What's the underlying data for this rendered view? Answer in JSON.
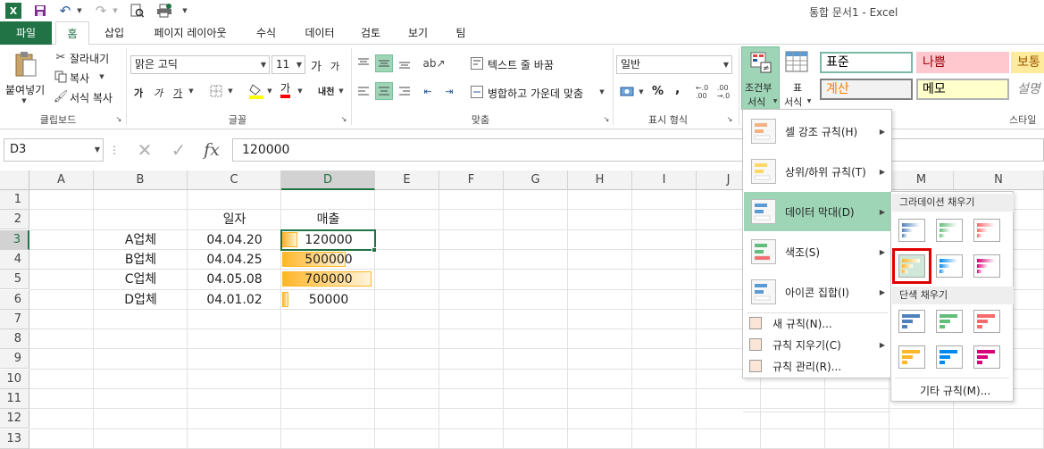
{
  "window": {
    "title": "통합 문서1 - Excel"
  },
  "tabs": [
    {
      "label": "파일"
    },
    {
      "label": "홈"
    },
    {
      "label": "삽입"
    },
    {
      "label": "페이지 레이아웃"
    },
    {
      "label": "수식"
    },
    {
      "label": "데이터"
    },
    {
      "label": "검토"
    },
    {
      "label": "보기"
    },
    {
      "label": "팀"
    }
  ],
  "ribbon": {
    "clipboard": {
      "paste": "붙여넣기",
      "cut": "잘라내기",
      "copy": "복사",
      "format_painter": "서식 복사",
      "group": "클립보드"
    },
    "font": {
      "name": "맑은 고딕",
      "size": "11",
      "group": "글꼴",
      "grow": "가",
      "shrink": "가",
      "bold": "가",
      "italic": "가",
      "underline": "가",
      "color_letter": "가",
      "phonetic": "내천"
    },
    "alignment": {
      "wrap": "텍스트 줄 바꿈",
      "merge": "병합하고 가운데 맞춤",
      "group": "맞춤"
    },
    "number": {
      "format": "일반",
      "group": "표시 형식",
      "percent": "%",
      "comma": ","
    },
    "styles": {
      "cond_format": "조건부 서식",
      "cond_format_line1": "조건부",
      "cond_format_line2": "서식",
      "table_format_line1": "표",
      "table_format_line2": "서식",
      "group": "스타일",
      "cells": [
        {
          "label": "표준",
          "bg": "#ffffff",
          "fg": "#000000",
          "border": "#7ab9a6"
        },
        {
          "label": "나쁨",
          "bg": "#ffc7ce",
          "fg": "#9c0006",
          "border": "#ffc7ce"
        },
        {
          "label": "보통",
          "bg": "#ffeb9c",
          "fg": "#9c5700",
          "border": "#ffeb9c"
        },
        {
          "label": "계산",
          "bg": "#f2f2f2",
          "fg": "#fa7d00",
          "border": "#7f7f7f"
        },
        {
          "label": "메모",
          "bg": "#ffffcc",
          "fg": "#000000",
          "border": "#b2b2b2"
        },
        {
          "label": "설명",
          "bg": "#ffffff",
          "fg": "#7f7f7f",
          "border": "#ffffff"
        }
      ]
    }
  },
  "formula_bar": {
    "name_box": "D3",
    "formula": "120000",
    "fx": "fx"
  },
  "columns": [
    "A",
    "B",
    "C",
    "D",
    "E",
    "F",
    "G",
    "H",
    "I",
    "J",
    "K",
    "L",
    "M",
    "N"
  ],
  "rows": [
    "1",
    "2",
    "3",
    "4",
    "5",
    "6",
    "7",
    "8",
    "9",
    "10",
    "11",
    "12",
    "13"
  ],
  "sheet": {
    "header_date": "일자",
    "header_sales": "매출",
    "data": [
      {
        "company": "A업체",
        "date": "04.04.20",
        "sales": "120000",
        "ratio": 0.171
      },
      {
        "company": "B업체",
        "date": "04.04.25",
        "sales": "500000",
        "ratio": 0.714
      },
      {
        "company": "C업체",
        "date": "04.05.08",
        "sales": "700000",
        "ratio": 1.0
      },
      {
        "company": "D업체",
        "date": "04.01.02",
        "sales": "50000",
        "ratio": 0.071
      }
    ]
  },
  "cond_menu": {
    "items": [
      {
        "label": "셀 강조 규칙(H)",
        "icon": "highlight-rules-icon"
      },
      {
        "label": "상위/하위 규칙(T)",
        "icon": "top-bottom-rules-icon"
      },
      {
        "label": "데이터 막대(D)",
        "icon": "data-bars-icon"
      },
      {
        "label": "색조(S)",
        "icon": "color-scales-icon"
      },
      {
        "label": "아이콘 집합(I)",
        "icon": "icon-sets-icon"
      }
    ],
    "small_items": [
      {
        "label": "새 규칙(N)...",
        "icon": "new-rule-icon"
      },
      {
        "label": "규칙 지우기(C)",
        "icon": "clear-rules-icon"
      },
      {
        "label": "규칙 관리(R)...",
        "icon": "manage-rules-icon"
      }
    ]
  },
  "databar_menu": {
    "gradient_header": "그라데이션 채우기",
    "solid_header": "단색 채우기",
    "more_rules": "기타 규칙(M)...",
    "colors": [
      "#4f81bd",
      "#63be7b",
      "#f8696b",
      "#ffb628",
      "#008aef",
      "#d6007b"
    ]
  },
  "accent": {
    "excel_green": "#217346",
    "menu_highlight": "#9fd5b7",
    "selection_red": "#e00000"
  }
}
